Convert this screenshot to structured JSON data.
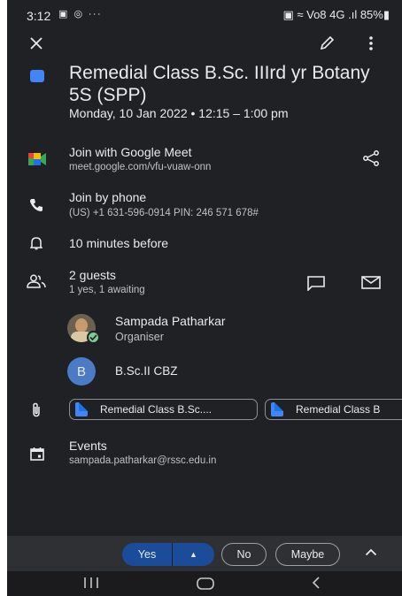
{
  "status": {
    "time": "3:12",
    "left_icons": "▣ ◎ ∙∙∙",
    "right_text": "▣ ≈ Vo8 4G .ıl 85%▮"
  },
  "event": {
    "title": "Remedial Class B.Sc. IIIrd yr Botany 5S (SPP)",
    "datetime": "Monday, 10 Jan 2022  •  12:15 – 1:00 pm",
    "color": "#4285f4"
  },
  "meet": {
    "label": "Join with Google Meet",
    "url": "meet.google.com/vfu-vuaw-onn"
  },
  "phone": {
    "label": "Join by phone",
    "detail": "(US) +1 631-596-0914 PIN: 246 571 678#"
  },
  "reminder": {
    "label": "10 minutes before"
  },
  "guests": {
    "title": "2 guests",
    "summary": "1 yes, 1 awaiting",
    "list": [
      {
        "name": "Sampada Patharkar",
        "role": "Organiser"
      },
      {
        "name": "B.Sc.II CBZ",
        "initial": "B"
      }
    ]
  },
  "attachments": [
    {
      "label": "Remedial Class B.Sc...."
    },
    {
      "label": "Remedial Class B"
    }
  ],
  "calendar": {
    "label": "Events",
    "account": "sampada.patharkar@rssc.edu.in"
  },
  "rsvp": {
    "yes": "Yes",
    "no": "No",
    "maybe": "Maybe"
  },
  "icons": [
    "close-icon",
    "edit-icon",
    "more-icon",
    "google-meet-icon",
    "share-icon",
    "phone-icon",
    "bell-icon",
    "people-icon",
    "chat-icon",
    "mail-icon",
    "attachment-icon",
    "calendar-icon",
    "expand-icon"
  ]
}
